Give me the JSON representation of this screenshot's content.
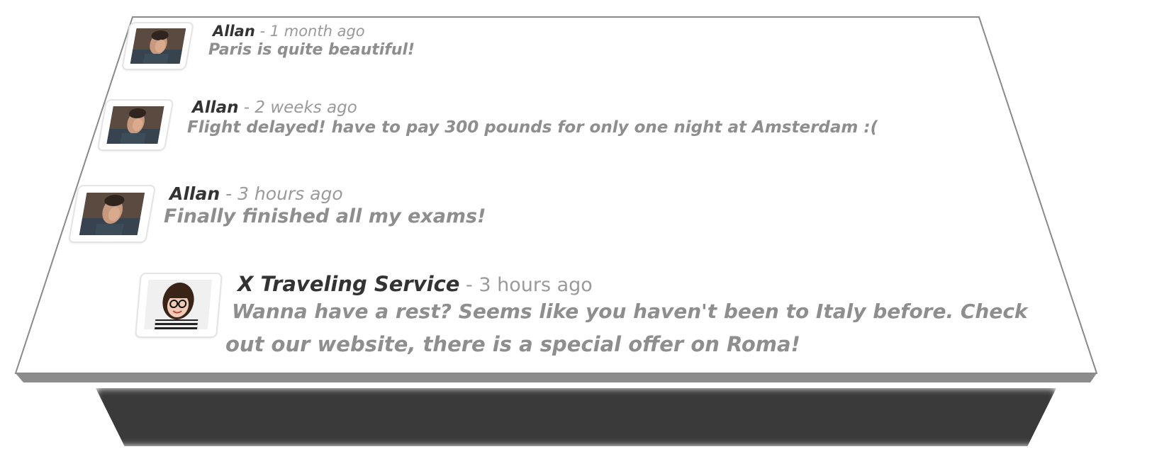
{
  "feed": {
    "items": [
      {
        "author": "Allan",
        "separator": " - ",
        "time": "1 month ago",
        "message": "Paris is quite beautiful!",
        "avatar": "man-facepalm-avatar"
      },
      {
        "author": "Allan",
        "separator": " - ",
        "time": "2 weeks ago",
        "message": "Flight delayed! have to pay 300 pounds for only one night at Amsterdam :(",
        "avatar": "man-facepalm-avatar"
      },
      {
        "author": "Allan",
        "separator": " - ",
        "time": "3 hours ago",
        "message": "Finally finished all my exams!",
        "avatar": "man-facepalm-avatar"
      },
      {
        "author": "X Traveling Service",
        "separator": " - ",
        "time": "3 hours ago",
        "message_line1": "Wanna have a rest? Seems like you haven't been to Italy before. Check",
        "message_line2": "out our website, there is a special offer on Roma!",
        "avatar": "woman-glasses-avatar"
      }
    ]
  },
  "colors": {
    "author": "#333333",
    "time": "#9a9a9a",
    "message": "#8e8e8e",
    "board_border": "#8a8a8a",
    "board_edge": "#8c8c8c",
    "shadow": "#3a3a3a"
  }
}
